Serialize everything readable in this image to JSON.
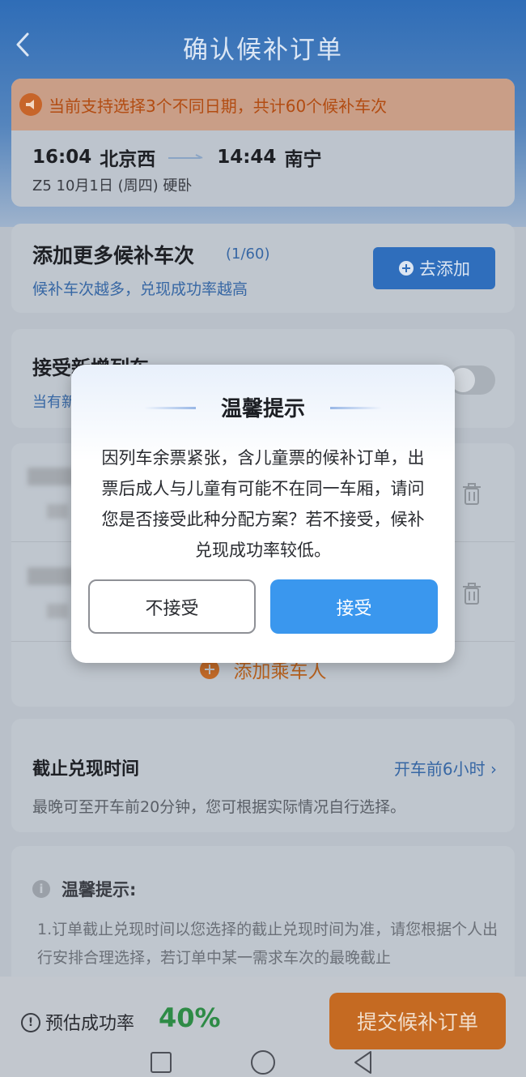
{
  "header": {
    "title": "确认候补订单"
  },
  "notice": {
    "text": "当前支持选择3个不同日期，共计60个候补车次"
  },
  "trip": {
    "depart_time": "16:04",
    "depart_station": "北京西",
    "arrive_time": "14:44",
    "arrive_station": "南宁",
    "detail": "Z5   10月1日 (周四) 硬卧"
  },
  "add_trains": {
    "title": "添加更多候补车次",
    "count": "(1/60)",
    "subtitle": "候补车次越多，兑现成功率越高",
    "button_label": "去添加"
  },
  "accept_new_train": {
    "title": "接受新增列车",
    "subtitle": "当有新"
  },
  "passengers": {
    "add_label": "添加乘车人"
  },
  "deadline": {
    "title": "截止兑现时间",
    "value": "开车前6小时",
    "subtitle": "最晚可至开车前20分钟，您可根据实际情况自行选择。"
  },
  "tips": {
    "title": "温馨提示:",
    "body": "1.订单截止兑现时间以您选择的截止兑现时间为准，请您根据个人出行安排合理选择，若订单中某一需求车次的最晚截止"
  },
  "bottom": {
    "rate_label": "预估成功率",
    "rate_value": "40%",
    "submit_label": "提交候补订单"
  },
  "modal": {
    "title": "温馨提示",
    "message": "因列车余票紧张，含儿童票的候补订单，出票后成人与儿童有可能不在同一车厢，请问您是否接受此种分配方案？若不接受，候补兑现成功率较低。",
    "decline_label": "不接受",
    "accept_label": "接受"
  },
  "colors": {
    "accent_blue": "#3a97ee",
    "submit_orange": "#c56a22",
    "rate_green": "#2e8b46"
  }
}
